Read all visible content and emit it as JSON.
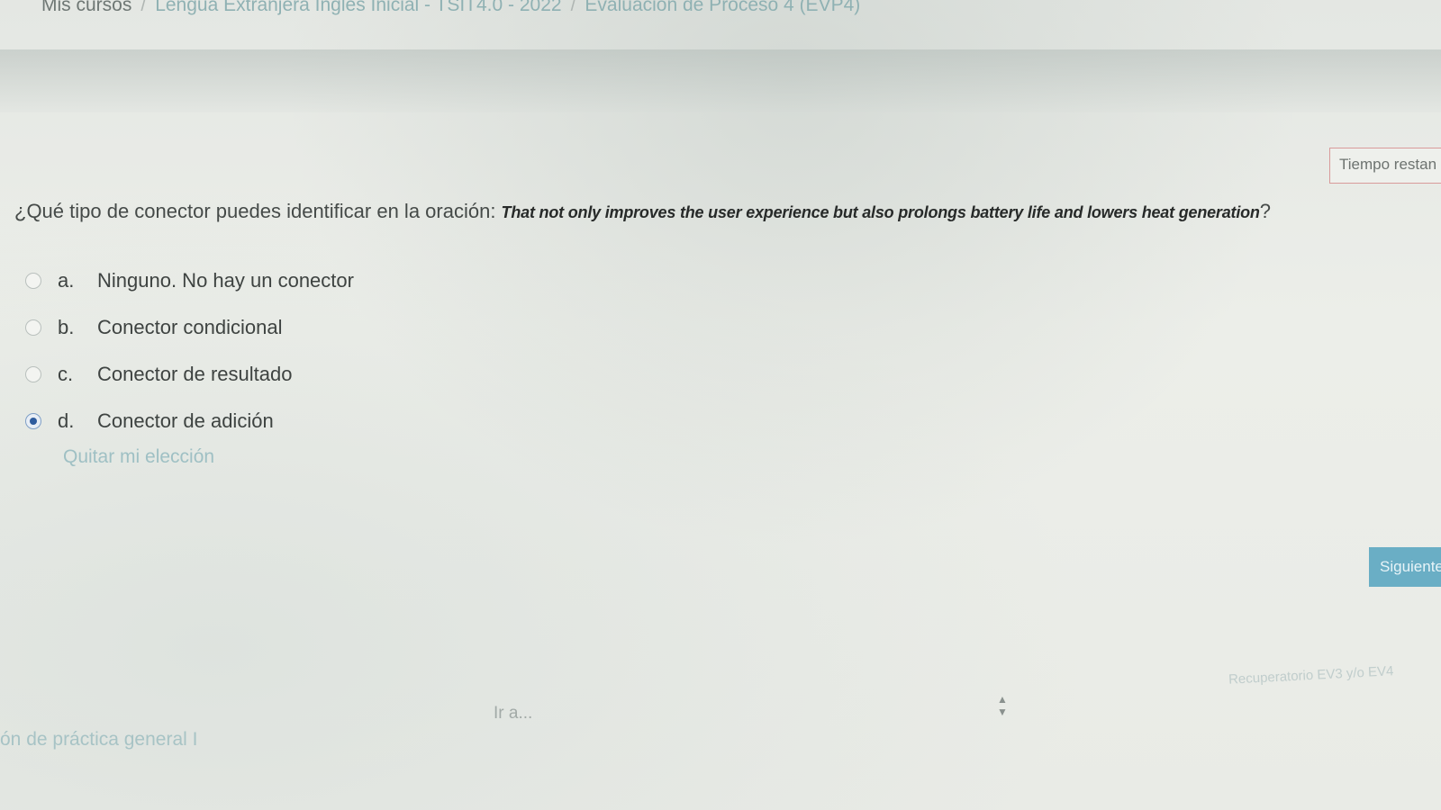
{
  "breadcrumb": {
    "home": "Mis cursos",
    "separator": "/",
    "course": "Lengua Extranjera Inglés Inicial - TSIT4.0 - 2022",
    "quiz": "Evaluación de Proceso 4 (EVP4)"
  },
  "timer": {
    "label": "Tiempo restan"
  },
  "question": {
    "prompt": "¿Qué tipo de conector puedes identificar en la oración: ",
    "sentence": "That not only improves the user experience but also prolongs battery life and lowers heat generation",
    "end": "?"
  },
  "answers": [
    {
      "letter": "a.",
      "text": "Ninguno. No hay un conector",
      "selected": false
    },
    {
      "letter": "b.",
      "text": "Conector condicional",
      "selected": false
    },
    {
      "letter": "c.",
      "text": "Conector de resultado",
      "selected": false
    },
    {
      "letter": "d.",
      "text": "Conector de adición",
      "selected": true
    }
  ],
  "actions": {
    "clear_choice": "Quitar mi elección",
    "next": "Siguiente"
  },
  "navigation": {
    "previous_activity": "ón de práctica general I",
    "jump_to": "Ir a...",
    "next_activity": "Recuperatorio EV3 y/o EV4"
  },
  "colors": {
    "link": "#8fb1b3",
    "selected_radio": "#2e5c9e",
    "next_button": "#6aaec5",
    "timer_border": "#d89a9a"
  }
}
